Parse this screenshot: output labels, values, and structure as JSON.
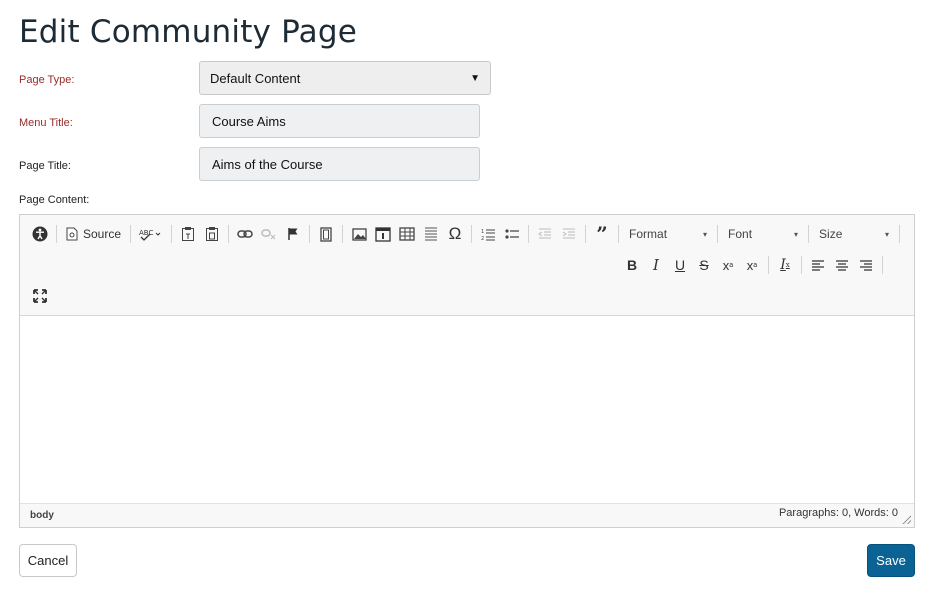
{
  "page": {
    "title": "Edit Community Page"
  },
  "form": {
    "page_type": {
      "label": "Page Type:",
      "value": "Default Content"
    },
    "menu_title": {
      "label": "Menu Title:",
      "value": "Course Aims"
    },
    "page_title": {
      "label": "Page Title:",
      "value": "Aims of the Course"
    },
    "page_content": {
      "label": "Page Content:"
    }
  },
  "editor": {
    "source_label": "Source",
    "format_label": "Format",
    "font_label": "Font",
    "size_label": "Size",
    "omega_glyph": "Ω",
    "status_path": "body",
    "word_count": "Paragraphs: 0, Words: 0",
    "icons": [
      "accessibility-icon",
      "source-icon",
      "spellcheck-icon",
      "paste-text-icon",
      "paste-word-icon",
      "link-icon",
      "unlink-icon",
      "anchor-flag-icon",
      "video-icon",
      "image-icon",
      "template-icon",
      "table-icon",
      "horizontal-rule-icon",
      "special-char-icon",
      "numbered-list-icon",
      "bulleted-list-icon",
      "outdent-icon",
      "indent-icon",
      "blockquote-icon",
      "bold-icon",
      "italic-icon",
      "underline-icon",
      "strikethrough-icon",
      "subscript-icon",
      "superscript-icon",
      "remove-format-icon",
      "align-left-icon",
      "align-center-icon",
      "align-right-icon",
      "maximize-icon"
    ]
  },
  "actions": {
    "cancel_label": "Cancel",
    "save_label": "Save"
  },
  "colors": {
    "required_label": "#9a2a2a",
    "save_button": "#0a6394",
    "heading": "#1d2b36"
  }
}
